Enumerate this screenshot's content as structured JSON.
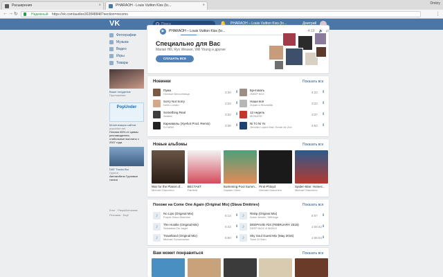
{
  "browser": {
    "tabs": [
      {
        "title": "Расширения",
        "active": false
      },
      {
        "title": "PHARAOH - Louis Vuitton Kiss (Io...",
        "active": true
      }
    ],
    "profile": "Dmitry",
    "secure_label": "Надежный",
    "url": "https://vk.com/audios302848848?section=recoms"
  },
  "header": {
    "search_placeholder": "Поиск",
    "player_text": "PHARAOH – Louis Vuitton Kiss (Io...",
    "user_name": "Дмитрий"
  },
  "left_nav": {
    "items": [
      {
        "label": "Фотографии",
        "icon": "photo-icon"
      },
      {
        "label": "Музыка",
        "icon": "music-icon"
      },
      {
        "label": "Видео",
        "icon": "video-icon"
      },
      {
        "label": "Игры",
        "icon": "games-icon"
      },
      {
        "label": "Товары",
        "icon": "goods-icon"
      }
    ]
  },
  "ads": [
    {
      "title": "Ваше похудение",
      "sub": "Приложение"
    },
    {
      "title": "Монетизация сайтов",
      "sub": "popunder.net",
      "text": "Платим 85% от суммы рекламодателя, стабильные выплаты с 2007 года."
    },
    {
      "title": "DAF Tracks Bor",
      "sub": "Группа",
      "text": "Автомобили Грузовые тягачи"
    }
  ],
  "footer_links": [
    "Блог",
    "Разработчикам",
    "Реклама",
    "Ещё"
  ],
  "player_bar": {
    "title": "PHARAOH – Louis Vuitton Kiss (Io...",
    "time": "-4:19",
    "progress": 0.15
  },
  "special": {
    "title": "Специально для Вас",
    "subtitle": "Marian Hill, Ryn Weaver, Will Young и другие",
    "button": "СЛУШАТЬ ВСЕ"
  },
  "new_tracks": {
    "title": "Новинки",
    "show_all": "Показать все",
    "tracks": [
      {
        "title": "Пума",
        "artist": "Ночные Бессонница",
        "duration": "3:30",
        "color": "#7a5a44"
      },
      {
        "title": "Sorry Not Sorry",
        "artist": "Demi Lovato",
        "duration": "2:23",
        "color": "#d6a88a"
      },
      {
        "title": "Something Real",
        "artist": "Astana",
        "duration": "3:32",
        "color": "#3d3d3d"
      },
      {
        "title": "Карнавалы (Xyehot Prod. Remix)",
        "artist": "DJ MAN",
        "duration": "3:38",
        "color": "#222222"
      },
      {
        "title": "Бунтовать",
        "artist": "ОМЕР КОЗ",
        "duration": "4:22",
        "color": "#9a8f85"
      },
      {
        "title": "Наше всё",
        "artist": "Зорин и Slevadilla",
        "duration": "3:22",
        "color": "#b7b7b7"
      },
      {
        "title": "12 недель",
        "artist": "MONATIK",
        "duration": "3:37",
        "color": "#c4372d"
      },
      {
        "title": "Ni Tú Ni Yo",
        "artist": "Jennifer Lopez feat. Gente de Zon",
        "duration": "3:52",
        "color": "#1e4270"
      }
    ]
  },
  "new_albums": {
    "title": "Новые альбомы",
    "show_all": "Показать все",
    "albums": [
      {
        "title": "War for the Planet of...",
        "artist": "Michael Giacchino",
        "color": "#4b3a2f"
      },
      {
        "title": "ВЕСТАКТ",
        "artist": "Fairfield",
        "color": "#d44b5c"
      },
      {
        "title": "Swimming Pool Summ...",
        "artist": "Captain Cities",
        "color": "#4fa07a"
      },
      {
        "title": "Pink Phloyd",
        "artist": "Michael Giacchino",
        "color": "#1a1a1a"
      },
      {
        "title": "Spider-Man: Homec...",
        "artist": "Michael Giacchino",
        "color": "#2d5a8c"
      }
    ]
  },
  "similar": {
    "title": "Похоже на Come One Again (Original Mix) (Slava Dmitriev)",
    "show_all": "Показать все",
    "tracks": [
      {
        "title": "No Lips (Original Mix)",
        "artist": "Purple Disco Machine",
        "duration": "6:13"
      },
      {
        "title": "The Hostile (Original Mix)",
        "artist": "Sebastian De Jager",
        "duration": "5:42"
      },
      {
        "title": "Travelland (Original Mix)",
        "artist": "Michael Schumacher",
        "duration": "6:50"
      },
      {
        "title": "Riskp (Original Mix)",
        "artist": "Anton Ishutin, Withings",
        "duration": "6:07"
      },
      {
        "title": "DEEPAVID #34 (FEBRUARY 2015)",
        "artist": "DEEPJACK & MIDKO",
        "duration": "1:04:42"
      },
      {
        "title": "Sky Soul Guest Mix (May 2016)",
        "artist": "Toxel & Holm",
        "duration": "1:05:54"
      }
    ]
  },
  "recommended": {
    "title": "Вам может понравиться",
    "show_all": "Показать все",
    "colors": [
      "#4a8fc2",
      "#c8a27a",
      "#3b3b3b",
      "#d9cbb0",
      "#6b3b2a"
    ]
  }
}
